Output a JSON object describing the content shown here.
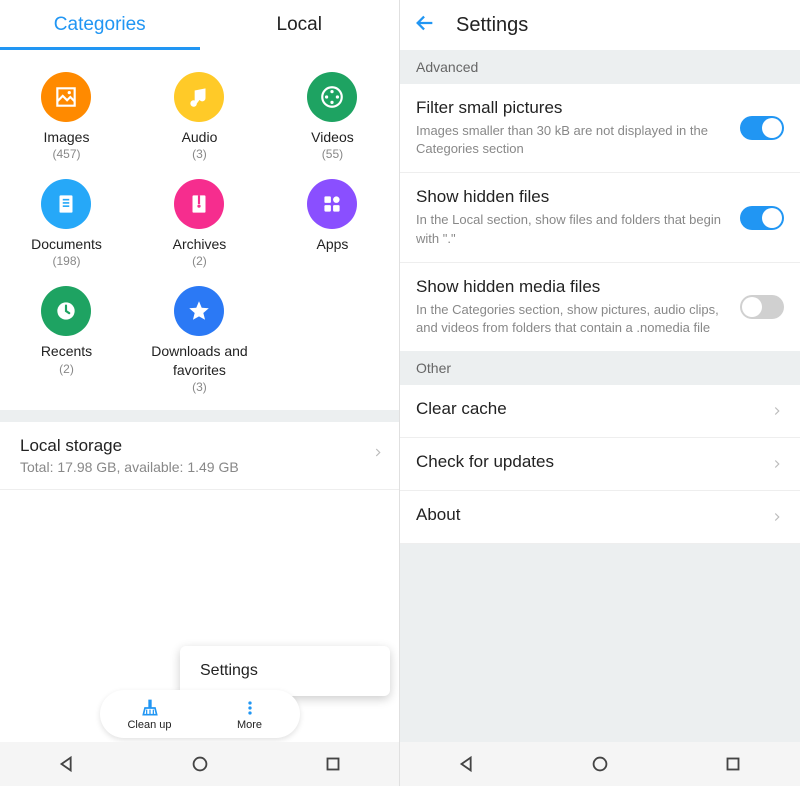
{
  "left": {
    "tabs": {
      "categories": "Categories",
      "local": "Local"
    },
    "categories": [
      {
        "label": "Images",
        "count": "(457)",
        "color": "#FF8A00",
        "icon": "image"
      },
      {
        "label": "Audio",
        "count": "(3)",
        "color": "#FFCA28",
        "icon": "note"
      },
      {
        "label": "Videos",
        "count": "(55)",
        "color": "#1EA362",
        "icon": "reel"
      },
      {
        "label": "Documents",
        "count": "(198)",
        "color": "#26A8F8",
        "icon": "doc"
      },
      {
        "label": "Archives",
        "count": "(2)",
        "color": "#F62D8E",
        "icon": "zip"
      },
      {
        "label": "Apps",
        "count": "",
        "color": "#8A4FFF",
        "icon": "apps"
      },
      {
        "label": "Recents",
        "count": "(2)",
        "color": "#1EA362",
        "icon": "clock"
      },
      {
        "label": "Downloads and favorites",
        "count": "(3)",
        "color": "#2B79F5",
        "icon": "star"
      }
    ],
    "storage": {
      "title": "Local storage",
      "sub": "Total: 17.98 GB, available: 1.49 GB"
    },
    "popup": {
      "label": "Settings"
    },
    "pill": {
      "cleanup": "Clean up",
      "more": "More"
    }
  },
  "right": {
    "header": {
      "title": "Settings"
    },
    "sections": {
      "advanced": "Advanced",
      "other": "Other"
    },
    "rows": {
      "filter": {
        "title": "Filter small pictures",
        "desc": "Images smaller than 30 kB are not displayed in the Categories section"
      },
      "hidden": {
        "title": "Show hidden files",
        "desc": "In the Local section, show files and folders that begin with \".\""
      },
      "media": {
        "title": "Show hidden media files",
        "desc": "In the Categories section, show pictures, audio clips, and videos from folders that contain a .nomedia file"
      },
      "clear": {
        "title": "Clear cache"
      },
      "update": {
        "title": "Check for updates"
      },
      "about": {
        "title": "About"
      }
    }
  }
}
